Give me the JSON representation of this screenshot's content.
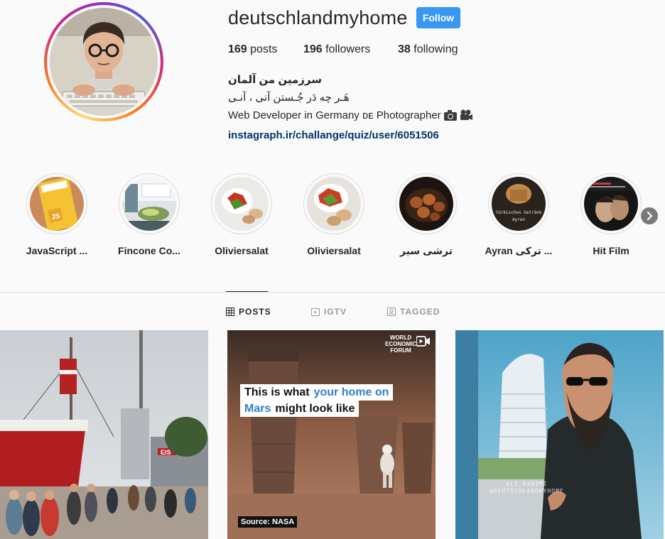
{
  "profile": {
    "username": "deutschlandmyhome",
    "follow_label": "Follow",
    "stats": {
      "posts_count": "169",
      "posts_label": "posts",
      "followers_count": "196",
      "followers_label": "followers",
      "following_count": "38",
      "following_label": "following"
    },
    "bio": {
      "name": "سرزمین من آلمان",
      "line1": "هَـر چه دَر جُـستن آنی ، آنـی",
      "line2": "Web Developer in Germany 🇩🇪 Photographer",
      "line2_text": "Web Developer in Germany ᴅᴇ Photographer",
      "link": "instagraph.ir/challange/quiz/user/6051506"
    }
  },
  "highlights": [
    {
      "label": "JavaScript ...",
      "icon": "javascript-book-cover"
    },
    {
      "label": "Fincone Co...",
      "icon": "conference-photo"
    },
    {
      "label": "Oliviersalat",
      "icon": "salad-plate"
    },
    {
      "label": "Oliviersalat",
      "icon": "salad-plate"
    },
    {
      "label": "ترشی سیر",
      "icon": "pickled-garlic-jar"
    },
    {
      "label": "Ayran ترکی ...",
      "icon": "turkish-coffee"
    },
    {
      "label": "Hit Film",
      "icon": "film-poster"
    }
  ],
  "tabs": [
    {
      "label": "POSTS",
      "active": true,
      "icon": "grid-icon"
    },
    {
      "label": "IGTV",
      "active": false,
      "icon": "tv-icon"
    },
    {
      "label": "TAGGED",
      "active": false,
      "icon": "tag-user-icon"
    }
  ],
  "posts": [
    {
      "kind": "photo",
      "subject": "lightship-harbor-crowd"
    },
    {
      "kind": "video",
      "headline_part1": "This is what ",
      "headline_highlight": "your home on",
      "headline_highlight2": "Mars",
      "headline_part2": " might look like",
      "brand": "WORLD ECONOMIC FORUM",
      "source": "Source: NASA"
    },
    {
      "kind": "photo",
      "subject": "bearded-man-portrait",
      "watermark_name": "ALI RAHIMI",
      "watermark_handle": "@DEUTSCHLANDMYHOME"
    }
  ],
  "colors": {
    "follow_button": "#3897f0",
    "link": "#003569",
    "text": "#262626",
    "muted": "#999999",
    "background": "#fafafa",
    "divider": "#dbdbdb"
  }
}
